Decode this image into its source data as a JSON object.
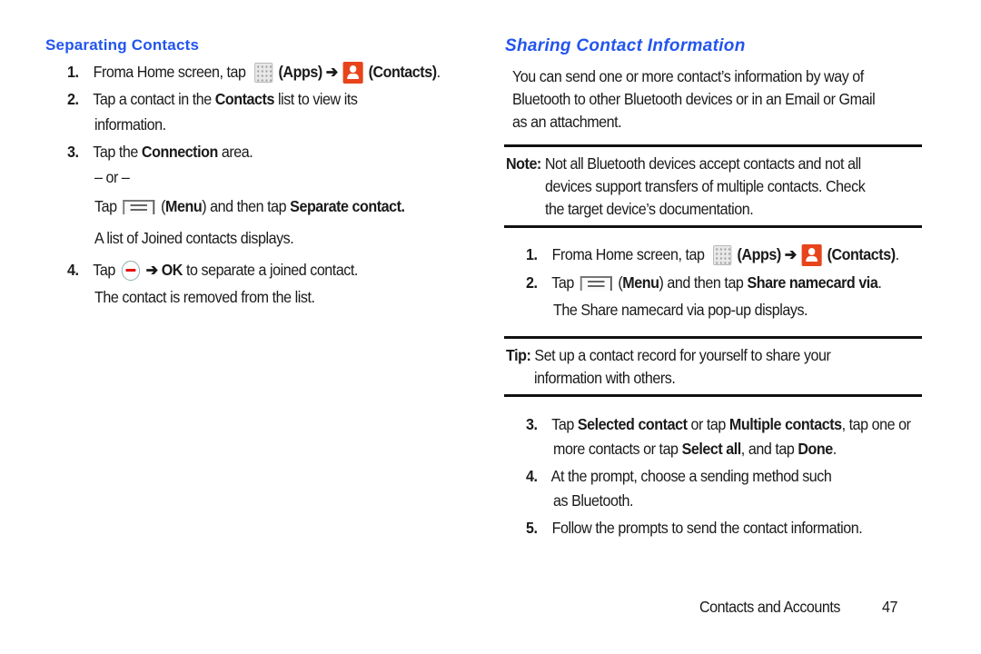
{
  "left": {
    "heading": "Separating Contacts",
    "steps": [
      {
        "num": "1.",
        "t1": "Froma Home screen, tap",
        "apps": "(Apps)",
        "arrow": "➔",
        "contacts": "(Contacts)",
        "end": "."
      },
      {
        "num": "2.",
        "t1": "Tap a contact in the ",
        "b1": "Contacts",
        "t2": " list to view its",
        "line2": "information."
      },
      {
        "num": "3.",
        "t1": "Tap the ",
        "b1": "Connection",
        "t2": " area.",
        "or": "– or –",
        "tap": "Tap",
        "menu_open": " (",
        "menu": "Menu",
        "menu_close": ") and then tap ",
        "b2": "Separate contact.",
        "result": "A list of Joined contacts displays."
      },
      {
        "num": "4.",
        "tap": "Tap",
        "arrow": "➔",
        "ok": "OK",
        "t1": " to separate a joined contact.",
        "result": "The contact is removed from the list."
      }
    ]
  },
  "right": {
    "heading": "Sharing Contact Information",
    "intro": [
      "You can send one or more contact’s information by way of",
      "Bluetooth to other Bluetooth devices or in an Email or Gmail",
      "as an attachment."
    ],
    "note": {
      "label": "Note:",
      "lines": [
        "Not all Bluetooth devices accept contacts and not all",
        "devices support transfers of multiple contacts. Check",
        "the target device’s documentation."
      ]
    },
    "steps_a": [
      {
        "num": "1.",
        "t1": "Froma Home screen, tap",
        "apps": "(Apps)",
        "arrow": "➔",
        "contacts": "(Contacts)",
        "end": "."
      },
      {
        "num": "2.",
        "tap": "Tap",
        "menu_open": " (",
        "menu": "Menu",
        "menu_close": ") and then tap ",
        "b1": "Share namecard via",
        "end": ".",
        "result": "The Share namecard via pop-up displays."
      }
    ],
    "tip": {
      "label": "Tip:",
      "lines": [
        "Set up a contact record for yourself to share your",
        "information with others."
      ]
    },
    "steps_b": [
      {
        "num": "3.",
        "t1": "Tap ",
        "b1": "Selected contact",
        "t2": " or tap ",
        "b2": "Multiple contacts",
        "t3": ", tap one or",
        "l2a": "more contacts or tap ",
        "b3": "Select all",
        "l2b": ", and tap ",
        "b4": "Done",
        "l2c": "."
      },
      {
        "num": "4.",
        "line1": "At the prompt, choose a sending method such",
        "line2": "as Bluetooth."
      },
      {
        "num": "5.",
        "line1": "Follow the prompts to send the contact information."
      }
    ]
  },
  "footer": {
    "section": "Contacts and Accounts",
    "page": "47"
  },
  "colors": {
    "heading": "#2255ee",
    "contacts_icon": "#e8441c",
    "minus": "#e01010"
  }
}
